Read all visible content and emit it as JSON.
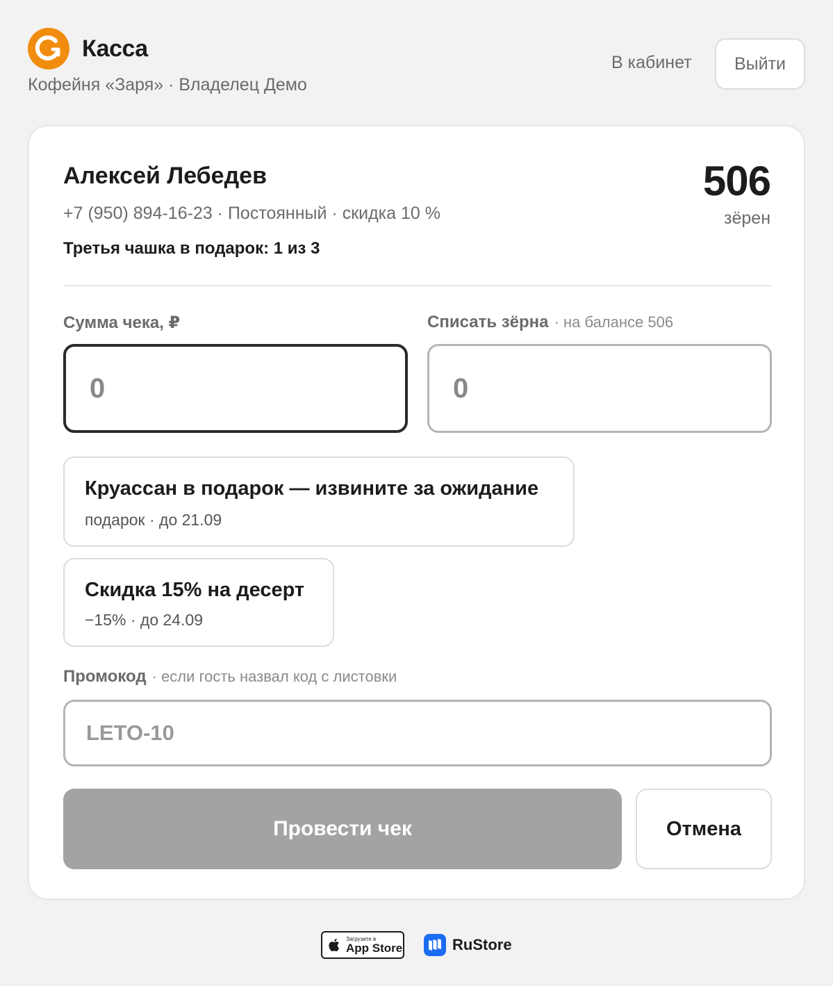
{
  "header": {
    "app_title": "Касса",
    "subtitle": "Кофейня «Заря» · Владелец Демо",
    "cabinet_link": "В кабинет",
    "logout_label": "Выйти",
    "brand_color": "#f28c0f"
  },
  "client": {
    "name": "Алексей Лебедев",
    "meta": "+7 (950) 894-16-23 · Постоянный · скидка 10 %",
    "promo_progress": "Третья чашка в подарок: 1 из 3",
    "balance": "506",
    "balance_unit": "зёрен"
  },
  "form": {
    "sum_label": "Сумма чека, ₽",
    "sum_value": "0",
    "beans_label": "Списать зёрна",
    "beans_hint": "· на балансе 506",
    "beans_value": "0",
    "promo_label": "Промокод",
    "promo_hint": "· если гость назвал код с листовки",
    "promo_placeholder": "LETO-10"
  },
  "offers": [
    {
      "title": "Круассан в подарок — извините за ожидание",
      "sub": "подарок · до 21.09"
    },
    {
      "title": "Скидка 15% на десерт",
      "sub": "−15% · до 24.09"
    }
  ],
  "actions": {
    "submit_label": "Провести чек",
    "cancel_label": "Отмена"
  },
  "footer": {
    "appstore_small": "Загрузите в",
    "appstore_big": "App Store",
    "rustore_label": "RuStore",
    "rustore_color": "#1b6cf2"
  }
}
